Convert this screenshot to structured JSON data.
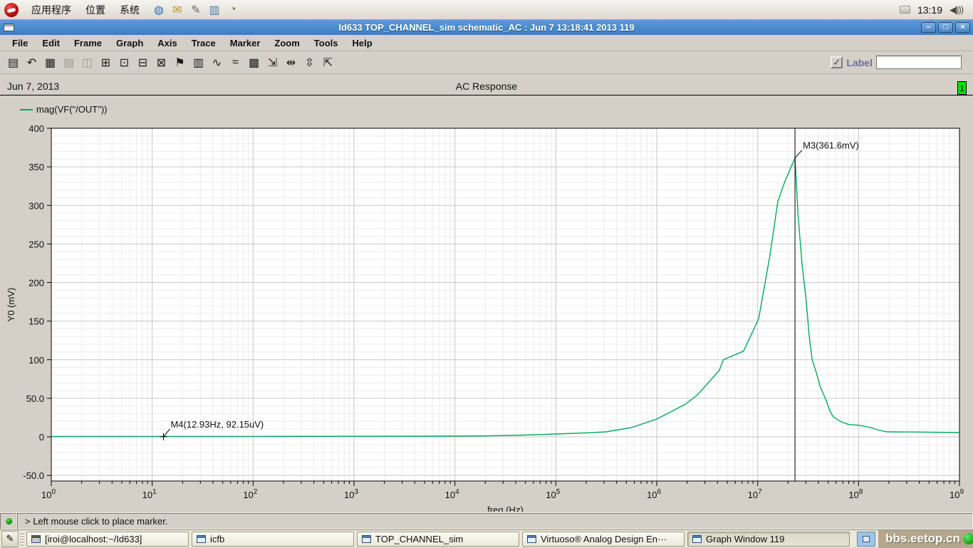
{
  "desktop_bar": {
    "menus": [
      "应用程序",
      "位置",
      "系统"
    ],
    "app_icons": [
      {
        "name": "web-browser-icon",
        "glyph": "◍",
        "color": "#2e6fba"
      },
      {
        "name": "email-icon",
        "glyph": "✉",
        "color": "#b8922e"
      },
      {
        "name": "notes-icon",
        "glyph": "✎",
        "color": "#6a6a6a"
      },
      {
        "name": "monitor-icon",
        "glyph": "▥",
        "color": "#4a7ab5"
      },
      {
        "name": "pie-chart-icon",
        "glyph": "◔",
        "color": "#8a6d3b"
      }
    ],
    "clock": "13:19",
    "volume_glyph": "◀)))"
  },
  "window": {
    "title": "Id633 TOP_CHANNEL_sim schematic_AC : Jun  7 13:18:41 2013 119",
    "controls": {
      "minimize": "–",
      "maximize": "□",
      "close": "×"
    },
    "menu_items": [
      "File",
      "Edit",
      "Frame",
      "Graph",
      "Axis",
      "Trace",
      "Marker",
      "Zoom",
      "Tools",
      "Help"
    ],
    "toolbar": {
      "buttons": [
        {
          "name": "print-icon",
          "glyph": "▤",
          "disabled": false
        },
        {
          "name": "undo-icon",
          "glyph": "↶",
          "disabled": false
        },
        {
          "name": "grid-icon",
          "glyph": "▦",
          "disabled": false
        },
        {
          "name": "strip-chart-icon",
          "glyph": "▤",
          "disabled": true
        },
        {
          "name": "overlay-icon",
          "glyph": "◫",
          "disabled": true
        },
        {
          "name": "split-window-icon",
          "glyph": "⊞",
          "disabled": false
        },
        {
          "name": "new-window-icon",
          "glyph": "⊡",
          "disabled": false
        },
        {
          "name": "subwindow-icon",
          "glyph": "⊟",
          "disabled": false
        },
        {
          "name": "pan-icon",
          "glyph": "⊠",
          "disabled": false
        },
        {
          "name": "marker-icon",
          "glyph": "⚑",
          "disabled": false
        },
        {
          "name": "table-icon",
          "glyph": "▥",
          "disabled": false
        },
        {
          "name": "waveform-icon",
          "glyph": "∿",
          "disabled": false
        },
        {
          "name": "eye-diagram-icon",
          "glyph": "≈",
          "disabled": false
        },
        {
          "name": "calculator-icon",
          "glyph": "▩",
          "disabled": false
        },
        {
          "name": "zoom-fit-icon",
          "glyph": "⇲",
          "disabled": false
        },
        {
          "name": "zoom-x-icon",
          "glyph": "⇹",
          "disabled": false
        },
        {
          "name": "zoom-y-icon",
          "glyph": "⇳",
          "disabled": false
        },
        {
          "name": "fit-window-icon",
          "glyph": "⇱",
          "disabled": false
        }
      ],
      "label_checkbox_text": "Label",
      "label_checkbox_checked": "✓",
      "label_input_value": ""
    }
  },
  "header": {
    "date": "Jun 7, 2013",
    "title": "AC Response",
    "page_badge": "1",
    "badge_color": "#00e400"
  },
  "legend": {
    "series_label": "mag(VF(\"/OUT\"))",
    "swatch_color": "#00a95c"
  },
  "chart_data": {
    "type": "line",
    "title": "AC Response",
    "xlabel": "freq (Hz)",
    "ylabel": "Y0 (mV)",
    "x_scale": "log10",
    "x_decades": [
      0,
      9
    ],
    "ylim": [
      -50,
      400
    ],
    "y_major_step": 50,
    "y_minor_step": 10,
    "y_tick_labels": [
      "400",
      "350",
      "300",
      "250",
      "200",
      "150",
      "100",
      "50.0",
      "0",
      "-50.0"
    ],
    "grid": true,
    "series": [
      {
        "name": "mag(VF(\"/OUT\"))",
        "color": "#00a95c",
        "points_log10f_mv": [
          [
            0,
            0.5
          ],
          [
            2,
            0.55
          ],
          [
            3,
            0.7
          ],
          [
            4,
            0.9
          ],
          [
            4.3,
            1.2
          ],
          [
            4.7,
            2.3
          ],
          [
            5.0,
            3.7
          ],
          [
            5.3,
            5.2
          ],
          [
            5.5,
            6.5
          ],
          [
            5.75,
            12
          ],
          [
            6.0,
            23
          ],
          [
            6.28,
            42
          ],
          [
            6.4,
            54
          ],
          [
            6.62,
            86
          ],
          [
            6.66,
            100
          ],
          [
            6.86,
            111
          ],
          [
            7.01,
            153
          ],
          [
            7.12,
            234
          ],
          [
            7.2,
            305
          ],
          [
            7.27,
            331
          ],
          [
            7.37,
            361.6
          ],
          [
            7.4,
            289
          ],
          [
            7.44,
            224
          ],
          [
            7.48,
            178
          ],
          [
            7.51,
            132
          ],
          [
            7.54,
            100
          ],
          [
            7.58,
            84
          ],
          [
            7.62,
            65
          ],
          [
            7.68,
            47
          ],
          [
            7.72,
            32
          ],
          [
            7.75,
            26
          ],
          [
            7.82,
            20
          ],
          [
            7.9,
            16
          ],
          [
            8.01,
            15
          ],
          [
            8.12,
            12
          ],
          [
            8.21,
            8.3
          ],
          [
            8.28,
            6.5
          ],
          [
            8.53,
            6.3
          ],
          [
            9.0,
            5.5
          ]
        ]
      }
    ],
    "markers": [
      {
        "name": "M3",
        "label": "M3(361.6mV)",
        "log10f": 7.37,
        "mv": 361.6,
        "style": "vline"
      },
      {
        "name": "M4",
        "label": "M4(12.93Hz, 92.15uV)",
        "log10f": 1.1116,
        "mv": 0.09,
        "style": "cross"
      }
    ]
  },
  "status_bar": {
    "message": "> Left mouse click to place marker."
  },
  "taskbar": {
    "show_desktop_glyph": "✎",
    "items": [
      {
        "label": "[iroi@localhost:~/Id633]",
        "icon": "terminal-icon",
        "active": false
      },
      {
        "label": "icfb",
        "icon": "window-icon",
        "active": false
      },
      {
        "label": "TOP_CHANNEL_sim",
        "icon": "window-icon",
        "active": false
      },
      {
        "label": "Virtuoso® Analog Design En···",
        "icon": "window-icon",
        "active": false
      },
      {
        "label": "Graph Window 119",
        "icon": "window-icon",
        "active": true
      }
    ],
    "watermark": "bbs.eetop.cn"
  }
}
